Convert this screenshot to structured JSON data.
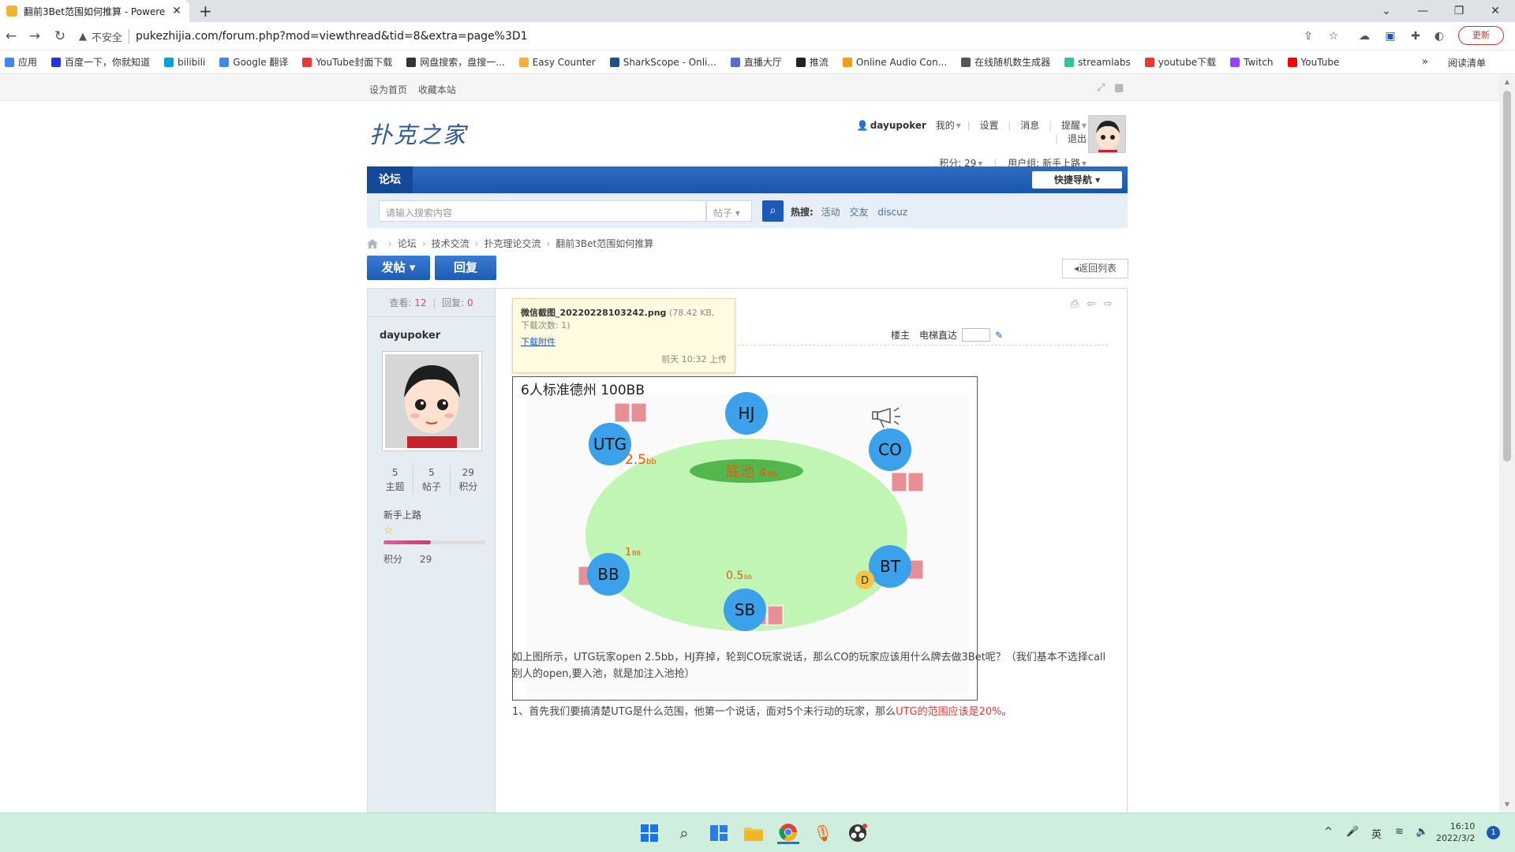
{
  "browser": {
    "tab_title": "翻前3Bet范围如何推算 - Powere",
    "tab_close": "✕",
    "new_tab": "+",
    "insecure_label": "不安全",
    "url": "pukezhijia.com/forum.php?mod=viewthread&tid=8&extra=page%3D1",
    "update_label": "更新",
    "bookmarks": [
      {
        "label": "应用",
        "color": "#4285f4"
      },
      {
        "label": "百度一下，你就知道",
        "color": "#2932e1"
      },
      {
        "label": "bilibili",
        "color": "#00a1d6"
      },
      {
        "label": "Google 翻译",
        "color": "#4285f4"
      },
      {
        "label": "YouTube封面下载",
        "color": "#e53935"
      },
      {
        "label": "网盘搜索，盘搜一...",
        "color": "#333333"
      },
      {
        "label": "Easy Counter",
        "color": "#f5b041"
      },
      {
        "label": "SharkScope - Onli...",
        "color": "#1f4e8c"
      },
      {
        "label": "直播大厅",
        "color": "#5b6bd6"
      },
      {
        "label": "推流",
        "color": "#222222"
      },
      {
        "label": "Online Audio Con...",
        "color": "#f39c12"
      },
      {
        "label": "在线随机数生成器",
        "color": "#555555"
      },
      {
        "label": "streamlabs",
        "color": "#31c3a2"
      },
      {
        "label": "youtube下载",
        "color": "#e53935"
      },
      {
        "label": "Twitch",
        "color": "#9146ff"
      },
      {
        "label": "YouTube",
        "color": "#ff0000"
      }
    ],
    "bookmarks_more": "»",
    "reading_list": "阅读清单"
  },
  "site": {
    "top_links": [
      "设为首页",
      "收藏本站"
    ],
    "logo": "扑克之家",
    "user": {
      "name": "dayupoker",
      "menu": [
        "我的",
        "设置",
        "消息",
        "提醒",
        "退出"
      ],
      "points": "积分: 29",
      "group": "用户组: 新手上路"
    },
    "nav_tab": "论坛",
    "quick_nav": "快捷导航",
    "search_placeholder": "请输入搜索内容",
    "search_type": "帖子",
    "hot_label": "热搜:",
    "hot_items": [
      "活动",
      "交友",
      "discuz"
    ],
    "breadcrumb": [
      "论坛",
      "技术交流",
      "扑克理论交流",
      "翻前3Bet范围如何推算"
    ],
    "post_button": "发帖",
    "reply_button": "回复",
    "back_to_list": "返回列表"
  },
  "post": {
    "views_label": "查看:",
    "views": "12",
    "replies_label": "回复:",
    "replies": "0",
    "author": "dayupoker",
    "stats": [
      {
        "value": "5",
        "label": "主题"
      },
      {
        "value": "5",
        "label": "帖子"
      },
      {
        "value": "29",
        "label": "积分"
      }
    ],
    "rank": "新手上路",
    "points_label": "积分",
    "points_value": "29",
    "progress": 0.46,
    "floor_label": "楼主",
    "jump_label": "电梯直达",
    "attachment": {
      "filename": "微信截图_20220228103242.png",
      "meta1": "(78.42 KB,",
      "meta2": "下载次数: 1)",
      "download": "下载附件",
      "uploaded": "前天 10:32 上传"
    },
    "image": {
      "title": "6人标准德州 100BB",
      "pot_label": "底池",
      "pot_amount": "4",
      "bb": "BB",
      "bb_lower": "bb",
      "seats": [
        "HJ",
        "UTG",
        "CO",
        "BB",
        "BT",
        "SB"
      ],
      "dealer": "D",
      "bets": {
        "utg": "2.5",
        "bb": "1",
        "sb": "0.5"
      }
    },
    "paragraph1": "如上图所示，UTG玩家open 2.5bb，HJ弃掉，轮到CO玩家说话，那么CO的玩家应该用什么牌去做3Bet呢？（我们基本不选择call别人的open,要入池，就是加注入池抢）",
    "paragraph2_normal": "1、首先我们要搞清楚UTG是什么范围，他第一个说话，面对5个未行动的玩家，那么",
    "paragraph2_red": "UTG的范围应该是20%",
    "paragraph2_end": "。"
  },
  "taskbar": {
    "lang": "英",
    "time": "16:10",
    "date": "2022/3/2",
    "notifications": "1"
  },
  "colors": {
    "nav_blue": "#1a55aa",
    "table_green": "#c0f5b4",
    "pot_green": "#52b84e",
    "seat_blue": "#3aa1ea",
    "card_pink": "#e88f95",
    "bet_orange": "#e8590c"
  }
}
